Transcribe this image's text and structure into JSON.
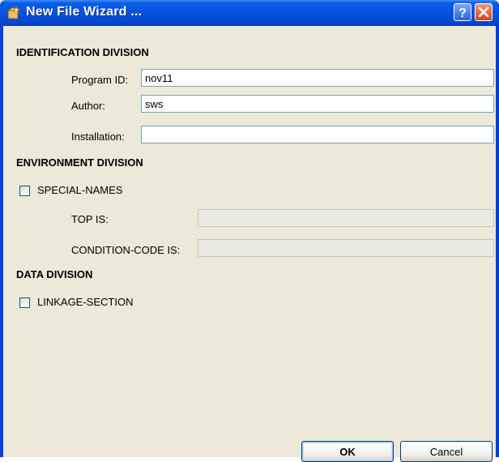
{
  "window": {
    "title": "New File Wizard ...",
    "help_glyph": "?",
    "close_glyph": "✕"
  },
  "identification": {
    "heading": "IDENTIFICATION DIVISION",
    "program_id_label": "Program ID:",
    "program_id_value": "nov11",
    "author_label": "Author:",
    "author_value": "sws",
    "installation_label": "Installation:",
    "installation_value": ""
  },
  "environment": {
    "heading": "ENVIRONMENT DIVISION",
    "special_names_label": "SPECIAL-NAMES",
    "special_names_checked": false,
    "top_is_label": "TOP IS:",
    "top_is_value": "",
    "condition_code_label": "CONDITION-CODE IS:",
    "condition_code_value": ""
  },
  "data_division": {
    "heading": "DATA DIVISION",
    "linkage_label": "LINKAGE-SECTION",
    "linkage_checked": false
  },
  "buttons": {
    "ok": "OK",
    "cancel": "Cancel"
  },
  "icons": {
    "title_icon": "wizard-icon",
    "help": "help-icon",
    "close": "close-icon"
  }
}
